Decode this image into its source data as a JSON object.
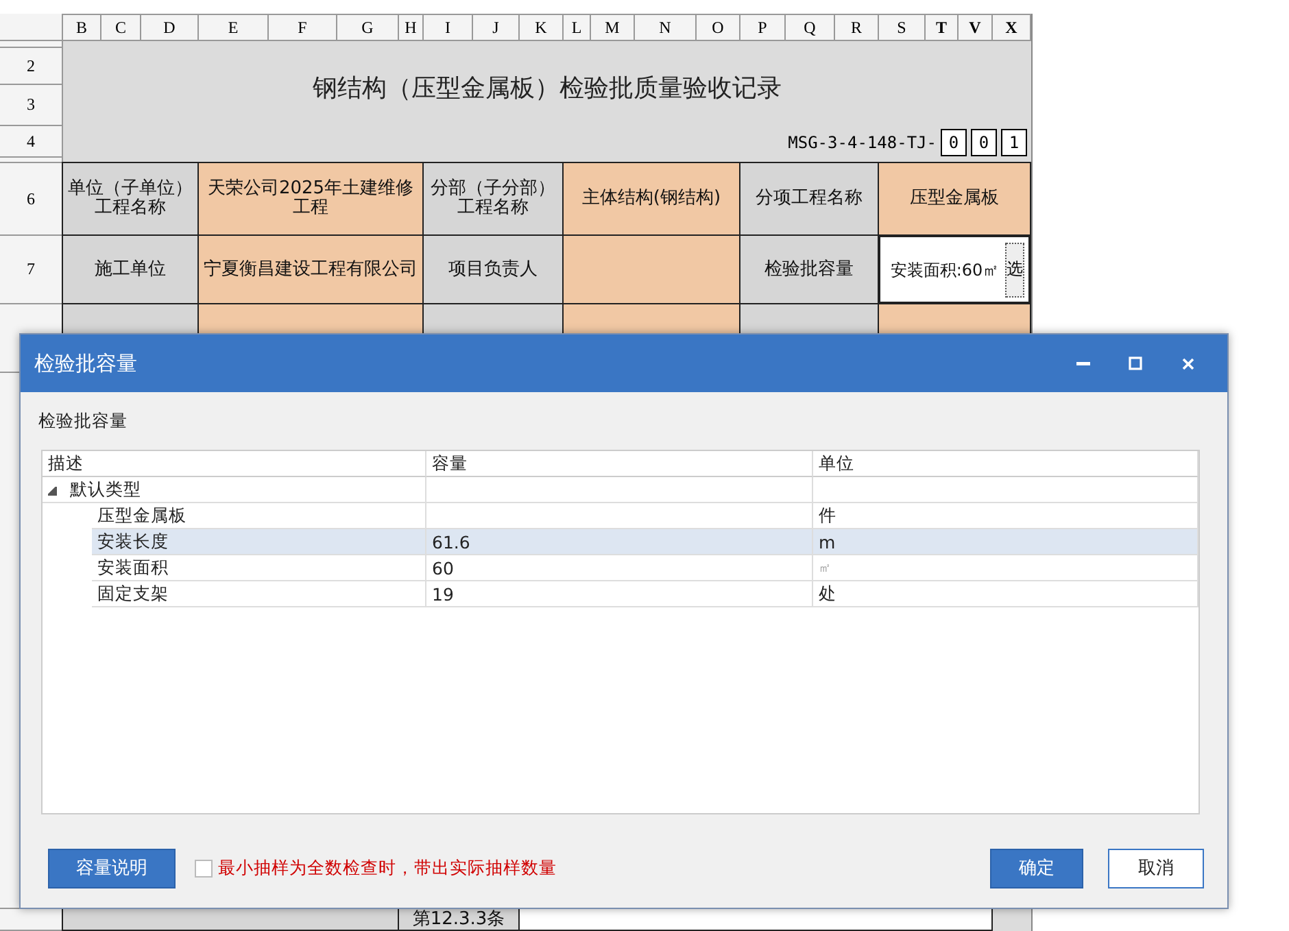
{
  "sheet": {
    "columns": [
      {
        "label": "B",
        "bold": false
      },
      {
        "label": "C",
        "bold": false
      },
      {
        "label": "D",
        "bold": false
      },
      {
        "label": "E",
        "bold": false
      },
      {
        "label": "F",
        "bold": false
      },
      {
        "label": "G",
        "bold": false
      },
      {
        "label": "H",
        "bold": false
      },
      {
        "label": "I",
        "bold": false
      },
      {
        "label": "J",
        "bold": false
      },
      {
        "label": "K",
        "bold": false
      },
      {
        "label": "L",
        "bold": false
      },
      {
        "label": "M",
        "bold": false
      },
      {
        "label": "N",
        "bold": false
      },
      {
        "label": "O",
        "bold": false
      },
      {
        "label": "P",
        "bold": false
      },
      {
        "label": "Q",
        "bold": false
      },
      {
        "label": "R",
        "bold": false
      },
      {
        "label": "S",
        "bold": false
      },
      {
        "label": "T",
        "bold": true
      },
      {
        "label": "V",
        "bold": true
      },
      {
        "label": "X",
        "bold": true
      }
    ],
    "row_numbers": [
      "2",
      "3",
      "4",
      "6",
      "7"
    ],
    "title": "钢结构（压型金属板）检验批质量验收记录",
    "code": {
      "prefix": "MSG-3-4-148-TJ-",
      "digits": [
        "0",
        "0",
        "1"
      ]
    },
    "info_rows": [
      [
        {
          "kind": "label",
          "text": "单位（子单位）工程名称"
        },
        {
          "kind": "value",
          "text": "天荣公司2025年土建维修工程"
        },
        {
          "kind": "label",
          "text": "分部（子分部）工程名称"
        },
        {
          "kind": "value",
          "text": "主体结构(钢结构)"
        },
        {
          "kind": "label",
          "text": "分项工程名称"
        },
        {
          "kind": "value",
          "text": "压型金属板"
        }
      ],
      [
        {
          "kind": "label",
          "text": "施工单位"
        },
        {
          "kind": "value",
          "text": "宁夏衡昌建设工程有限公司"
        },
        {
          "kind": "label",
          "text": "项目负责人"
        },
        {
          "kind": "value"
        },
        {
          "kind": "label",
          "text": "检验批容量"
        },
        {
          "kind": "picker",
          "text": "安装面积:60㎡",
          "button": "选"
        }
      ],
      [
        {
          "kind": "label"
        },
        {
          "kind": "value"
        },
        {
          "kind": "label"
        },
        {
          "kind": "value"
        },
        {
          "kind": "label"
        },
        {
          "kind": "value"
        }
      ]
    ],
    "bottom_cell": "第12.3.3条"
  },
  "dialog": {
    "title": "检验批容量",
    "group_label": "检验批容量",
    "grid": {
      "columns": [
        "描述",
        "容量",
        "单位"
      ],
      "rows": [
        {
          "name": "默认类型",
          "expanded": true,
          "selected": false,
          "children": [
            {
              "name": "压型金属板",
              "unit": "件",
              "unit_muted": false,
              "selected": false
            },
            {
              "name": "安装长度",
              "capacity": "61.6",
              "unit": "m",
              "unit_muted": false,
              "selected": true
            },
            {
              "name": "安装面积",
              "capacity": "60",
              "unit": "㎡",
              "unit_muted": true,
              "selected": false
            },
            {
              "name": "固定支架",
              "capacity": "19",
              "unit": "处",
              "unit_muted": false,
              "selected": false
            }
          ]
        }
      ]
    },
    "help_button": "容量说明",
    "checkbox": {
      "label": "最小抽样为全数检查时，带出实际抽样数量",
      "checked": false
    },
    "buttons": [
      {
        "label": "确定",
        "primary": true
      },
      {
        "label": "取消",
        "primary": false
      }
    ]
  }
}
